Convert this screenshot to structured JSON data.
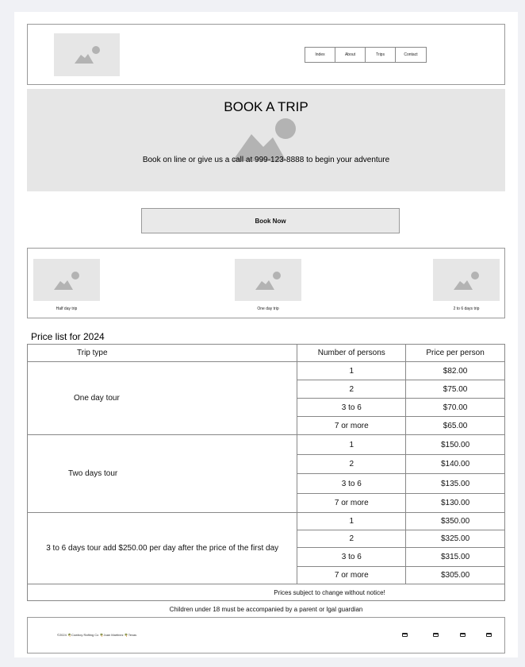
{
  "nav": {
    "items": [
      "Index",
      "About",
      "Trips",
      "Contact"
    ]
  },
  "hero": {
    "title": "BOOK A TRIP",
    "text": "Book on line or give us a call at 999-123-8888 to begin your adventure"
  },
  "book_button": "Book Now",
  "trips": [
    {
      "label": "Half day trip"
    },
    {
      "label": "One day trip"
    },
    {
      "label": "2 to 6 days trip"
    }
  ],
  "price_list": {
    "title": "Price list for 2024",
    "headers": [
      "Trip type",
      "Number of persons",
      "Price per person"
    ],
    "groups": [
      {
        "type": "One day tour",
        "rows": [
          [
            "1",
            "$82.00"
          ],
          [
            "2",
            "$75.00"
          ],
          [
            "3 to 6",
            "$70.00"
          ],
          [
            "7 or more",
            "$65.00"
          ]
        ]
      },
      {
        "type": "Two days tour",
        "rows": [
          [
            "1",
            "$150.00"
          ],
          [
            "2",
            "$140.00"
          ],
          [
            "3 to 6",
            "$135.00"
          ],
          [
            "7 or more",
            "$130.00"
          ]
        ]
      },
      {
        "type": "3 to 6 days tour add $250.00 per day after the price of the first day",
        "rows": [
          [
            "1",
            "$350.00"
          ],
          [
            "2",
            "$325.00"
          ],
          [
            "3 to 6",
            "$315.00"
          ],
          [
            "7 or more",
            "$305.00"
          ]
        ]
      }
    ],
    "notice": "Prices subject to change without notice!",
    "children_note": "Children under 18 must be accompanied by a parent or lgal guardian"
  },
  "footer": {
    "text": "©2024 🌴Cowboy Rafting Co 🌴Juan Martinez 🌴Texas",
    "icons": [
      "social-icon-1",
      "social-icon-2",
      "social-icon-3",
      "social-icon-4"
    ]
  },
  "colors": {
    "placeholder_bg": "#e6e6e6",
    "placeholder_icon": "#b3b3b3",
    "border": "#999999"
  }
}
